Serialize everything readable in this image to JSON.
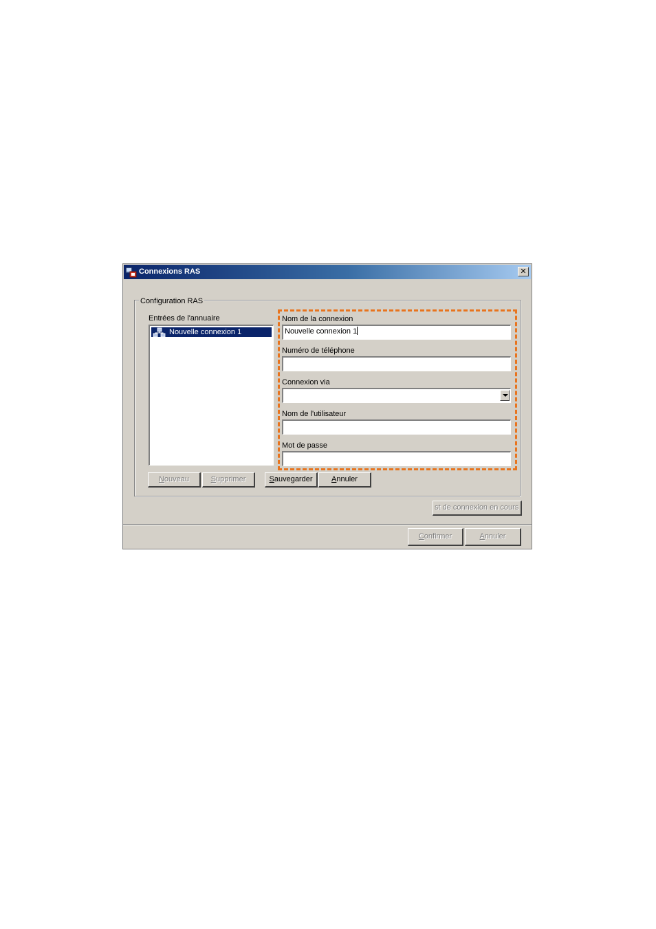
{
  "window": {
    "title": "Connexions RAS",
    "close_glyph": "✕"
  },
  "group": {
    "legend": "Configuration RAS"
  },
  "directory": {
    "label": "Entrées de l'annuaire",
    "items": [
      {
        "label": "Nouvelle connexion 1",
        "selected": true,
        "icon": "network-connection-icon"
      }
    ]
  },
  "fields": {
    "connection_name": {
      "label": "Nom de la connexion",
      "value": "Nouvelle connexion 1"
    },
    "phone_number": {
      "label": "Numéro de téléphone",
      "value": ""
    },
    "connect_via": {
      "label": "Connexion via",
      "value": ""
    },
    "username": {
      "label": "Nom de l'utilisateur",
      "value": ""
    },
    "password": {
      "label": "Mot de passe",
      "value": ""
    }
  },
  "buttons": {
    "new_first": "N",
    "new_rest": "ouveau",
    "delete_first": "S",
    "delete_rest": "upprimer",
    "save_first": "S",
    "save_rest": "auvegarder",
    "cancel_first": "A",
    "cancel_rest": "nnuler",
    "test_connection": "st de connexion en cours",
    "confirm_first": "C",
    "confirm_rest": "onfirmer",
    "cancel2_first": "A",
    "cancel2_rest": "nnuler"
  },
  "colors": {
    "highlight": "#e8741e",
    "selection": "#0a246a",
    "titlebar_start": "#0a246a",
    "titlebar_end": "#a6caf0"
  }
}
